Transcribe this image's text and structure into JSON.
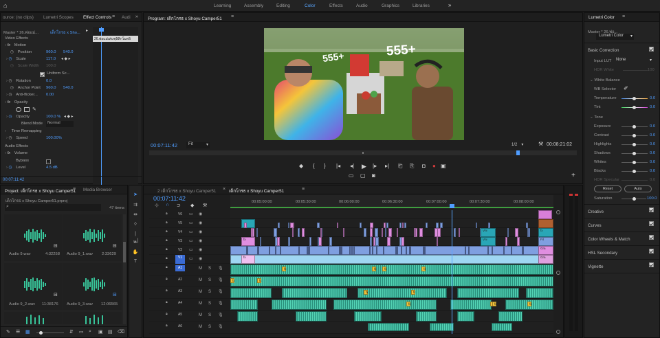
{
  "workspaces": [
    {
      "label": "Learning",
      "active": false
    },
    {
      "label": "Assembly",
      "active": false
    },
    {
      "label": "Editing",
      "active": false
    },
    {
      "label": "Color",
      "active": true
    },
    {
      "label": "Effects",
      "active": false
    },
    {
      "label": "Audio",
      "active": false
    },
    {
      "label": "Graphics",
      "active": false
    },
    {
      "label": "Libraries",
      "active": false
    }
  ],
  "source_panel": {
    "tabs": [
      "ource: (no clips)",
      "Lumetri Scopes",
      "Effect Controls",
      "Audi"
    ],
    "master_label": "Master * 26.พ่อแม่...",
    "clip_label": "เด็กโกรธ x Sho...",
    "clip_bar_label": "26.พ่อแม่เล่นชุษิลิกโมตอิ",
    "video_effects": "Video Effects",
    "motion": "Motion",
    "position_label": "Position",
    "position_x": "960.0",
    "position_y": "540.0",
    "scale_label": "Scale",
    "scale_value": "117.0",
    "scale_width_label": "Scale Width",
    "scale_width_value": "100.0",
    "uniform_scale": "Uniform Sc...",
    "rotation_label": "Rotation",
    "rotation_value": "0.0",
    "anchor_label": "Anchor Point",
    "anchor_x": "960.0",
    "anchor_y": "540.0",
    "antiflicker_label": "Anti-flicker...",
    "antiflicker_value": "0.00",
    "opacity": "Opacity",
    "opacity_label": "Opacity",
    "opacity_value": "100.0 %",
    "blend_label": "Blend Mode",
    "blend_value": "Normal",
    "time_remap": "Time Remapping",
    "speed_label": "Speed",
    "speed_value": "100.00%",
    "audio_effects": "Audio Effects",
    "volume": "Volume",
    "bypass_label": "Bypass",
    "level_label": "Level",
    "level_value": "4.5 dB",
    "timecode": "00:07:11:42"
  },
  "program": {
    "title": "Program: เด็กโกรธ x Shoyu Camper51",
    "overlay_left": "555+",
    "overlay_right": "555+",
    "timecode": "00:07:11:42",
    "fit": "Fit",
    "resolution": "1/2",
    "duration": "00:08:21:02"
  },
  "project": {
    "tabs": [
      "Project: เด็กโกรธ x Shoyu Camper51",
      "Media Browser"
    ],
    "file": "เด็กโกรธ x Shoyu Camper51.prproj",
    "items_count": "47 items",
    "items": [
      {
        "name": "Audio 9.wav",
        "duration": "4:32258"
      },
      {
        "name": "Audio 9_1.wav",
        "duration": "2:33629"
      },
      {
        "name": "Audio 9_2.wav",
        "duration": "11:38176"
      },
      {
        "name": "Audio 9_3.wav",
        "duration": "12:06565"
      }
    ]
  },
  "timeline": {
    "tabs": [
      "2 เด็กโกรธ x Shoyu Camper51",
      "เด็กโกรธ x Shoyu Camper51"
    ],
    "timecode": "00:07:11:42",
    "ruler": [
      "00:05:00:00",
      "00:05:30:00",
      "00:06:00:00",
      "00:06:30:00",
      "00:07:00:00",
      "00:07:30:00",
      "00:08:00:00"
    ],
    "video_tracks": [
      "V6",
      "V5",
      "V4",
      "V3",
      "V2",
      "V1"
    ],
    "audio_tracks": [
      "A1",
      "A2",
      "A3",
      "A4",
      "A5",
      "A6"
    ],
    "track_m": "M",
    "track_s": "S",
    "clip_fx": "fx",
    "clip_label_vni": "Vni",
    "clip_label_fil": "Fil",
    "clip_label_gra": "Gra"
  },
  "lumetri": {
    "title": "Lumetri Color",
    "master": "Master * 26.พ่อ...",
    "clip": "Lumetri Color",
    "basic": "Basic Correction",
    "input_lut": "Input LUT",
    "input_lut_value": "None",
    "hdr_white": "HDR White",
    "hdr_white_value": "100",
    "white_balance": "White Balance",
    "wb_selector": "WB Selector",
    "temperature": "Temperature",
    "temperature_value": "0.0",
    "tint": "Tint",
    "tint_value": "0.0",
    "tone": "Tone",
    "exposure": "Exposure",
    "exposure_value": "0.0",
    "contrast": "Contrast",
    "contrast_value": "0.0",
    "highlights": "Highlights",
    "highlights_value": "0.0",
    "shadows": "Shadows",
    "shadows_value": "0.0",
    "whites": "Whites",
    "whites_value": "0.0",
    "blacks": "Blacks",
    "blacks_value": "0.0",
    "hdr_specular": "HDR Specular",
    "hdr_specular_value": "0.0",
    "reset": "Reset",
    "auto": "Auto",
    "saturation": "Saturation",
    "saturation_value": "100.0",
    "creative": "Creative",
    "curves": "Curves",
    "wheels": "Color Wheels & Match",
    "hsl": "HSL Secondary",
    "vignette": "Vignette"
  },
  "colors": {
    "accent": "#4f9dff",
    "clip_video": "#7f9fe0",
    "clip_v1": "#9fd6f2",
    "clip_audio": "#3fb59d",
    "clip_pink": "#e08ee0",
    "clip_teal": "#29a6b6",
    "playhead": "#5aa6ff"
  }
}
